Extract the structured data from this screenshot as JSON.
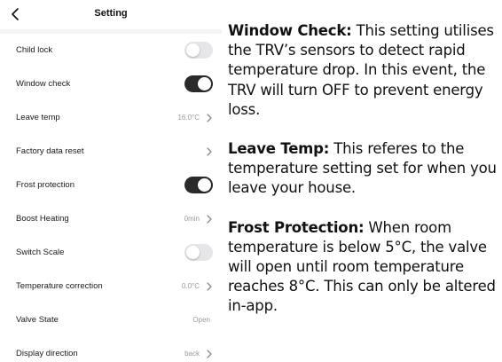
{
  "header": {
    "title": "Setting",
    "back_label": "<"
  },
  "settings": [
    {
      "label": "Child lock",
      "control": "toggle",
      "on": false
    },
    {
      "label": "Window check",
      "control": "toggle",
      "on": true
    },
    {
      "label": "Leave temp",
      "control": "value",
      "value": "16.0°C"
    },
    {
      "label": "Factory data reset",
      "control": "arrow"
    },
    {
      "label": "Frost protection",
      "control": "toggle",
      "on": true
    },
    {
      "label": "Boost Heating",
      "control": "value",
      "value": "0min"
    },
    {
      "label": "Switch Scale",
      "control": "toggle",
      "on": false
    },
    {
      "label": "Temperature correction",
      "control": "value",
      "value": "0.0°C"
    },
    {
      "label": "Valve State",
      "control": "text",
      "value": "Open"
    },
    {
      "label": "Display direction",
      "control": "value",
      "value": "back"
    }
  ],
  "notes": [
    {
      "title": "Window Check:",
      "text": " This setting utilises the TRV’s sensors to detect rapid temperature drop. In this event, the TRV will turn OFF to prevent energy loss."
    },
    {
      "title": "Leave Temp:",
      "text": " This referes to the temperature setting set for when you leave your house."
    },
    {
      "title": "Frost Protection:",
      "text": " When room temperature is below 5°C, the valve will open until room temperature reaches 8°C. This can only be altered in-app."
    }
  ],
  "colors": {
    "toggle_on": "#2a2a2a",
    "toggle_off": "#e6e6e8",
    "panel_bg": "#f4f4f6"
  }
}
